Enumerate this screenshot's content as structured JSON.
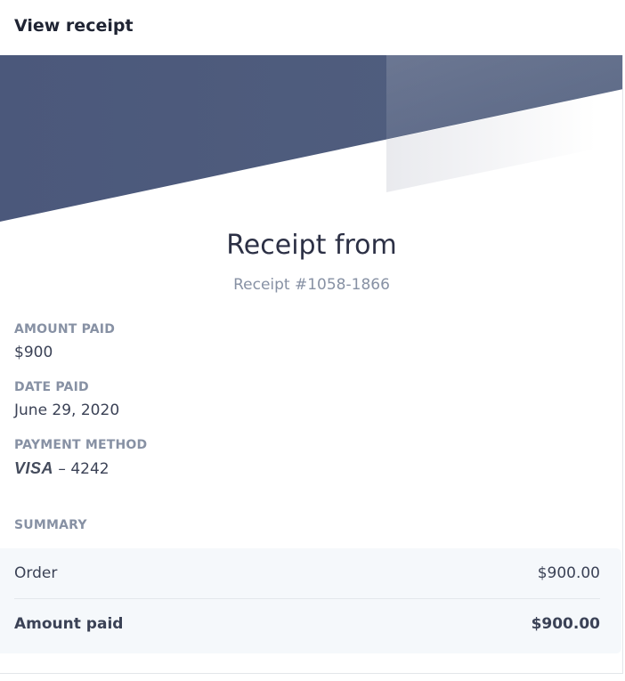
{
  "header": {
    "title": "View receipt"
  },
  "receipt": {
    "heading": "Receipt from",
    "number": "Receipt #1058-1866",
    "amount_paid_label": "AMOUNT PAID",
    "amount_paid_value": "$900",
    "date_paid_label": "DATE PAID",
    "date_paid_value": "June 29, 2020",
    "payment_method_label": "PAYMENT METHOD",
    "payment_method_brand": "VISA",
    "payment_method_separator": "–",
    "payment_method_last4": "4242",
    "summary_label": "SUMMARY",
    "summary": {
      "order_label": "Order",
      "order_value": "$900.00",
      "total_label": "Amount paid",
      "total_value": "$900.00"
    }
  },
  "colors": {
    "banner": "#4d5a7c",
    "accent_text": "#8791a4",
    "summary_bg": "#f5f8fb"
  },
  "icons": {
    "card_brand": "visa-logo"
  }
}
